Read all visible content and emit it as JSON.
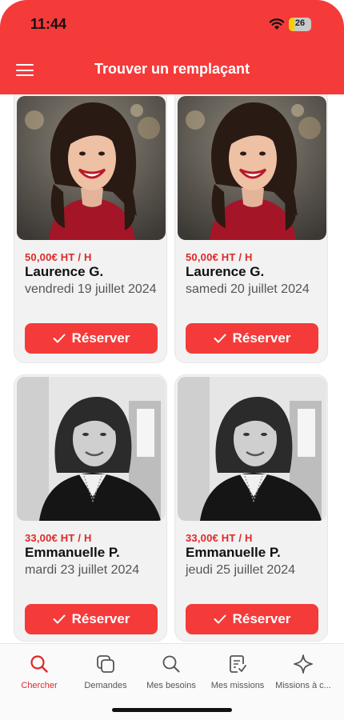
{
  "status_bar": {
    "time": "11:44",
    "battery": "26",
    "battery_level": 0.26
  },
  "header": {
    "title": "Trouver un remplaçant"
  },
  "cards": [
    {
      "price": "50,00€ HT / H",
      "name": "Laurence G.",
      "date": "vendredi 19 juillet 2024",
      "button": "Réserver",
      "photo": "smiling-woman-red-top-photo"
    },
    {
      "price": "50,00€ HT / H",
      "name": "Laurence G.",
      "date": "samedi 20 juillet 2024",
      "button": "Réserver",
      "photo": "smiling-woman-red-top-photo"
    },
    {
      "price": "33,00€ HT / H",
      "name": "Emmanuelle P.",
      "date": "mardi 23 juillet 2024",
      "button": "Réserver",
      "photo": "black-and-white-woman-photo"
    },
    {
      "price": "33,00€ HT / H",
      "name": "Emmanuelle P.",
      "date": "jeudi 25 juillet 2024",
      "button": "Réserver",
      "photo": "black-and-white-woman-photo"
    }
  ],
  "tabs": [
    {
      "label": "Chercher",
      "icon": "search-icon",
      "active": true
    },
    {
      "label": "Demandes",
      "icon": "stacked-cards-icon",
      "active": false
    },
    {
      "label": "Mes besoins",
      "icon": "search-icon",
      "active": false
    },
    {
      "label": "Mes missions",
      "icon": "document-check-icon",
      "active": false
    },
    {
      "label": "Missions à c...",
      "icon": "sparkle-icon",
      "active": false
    }
  ],
  "colors": {
    "accent": "#f53a3a",
    "price": "#e02828",
    "card_bg": "#f2f2f2"
  }
}
